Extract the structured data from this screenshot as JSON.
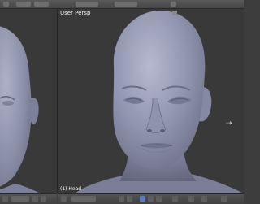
{
  "window": {
    "menu_items": [
      "",
      "",
      ""
    ],
    "screen_layout": "",
    "scene": ""
  },
  "viewport_left": {
    "label": "",
    "object_label": ""
  },
  "viewport_right": {
    "label": "User Persp",
    "object_label": "(1) Head",
    "icons": {
      "rotate_cursor": "rotate-cursor-icon",
      "view_toggle": "view-toggle-icon"
    }
  },
  "bottom_bar": {
    "mode": "",
    "tools": [
      "select-icon",
      "mesh-icon",
      "vertex-select-icon",
      "edge-select-icon",
      "face-select-icon",
      "lock-icon"
    ]
  },
  "colors": {
    "viewport_bg": "#393939",
    "head": "#8f93ad",
    "toolbar": "#4a4a4a",
    "accent": "#5680c2"
  }
}
